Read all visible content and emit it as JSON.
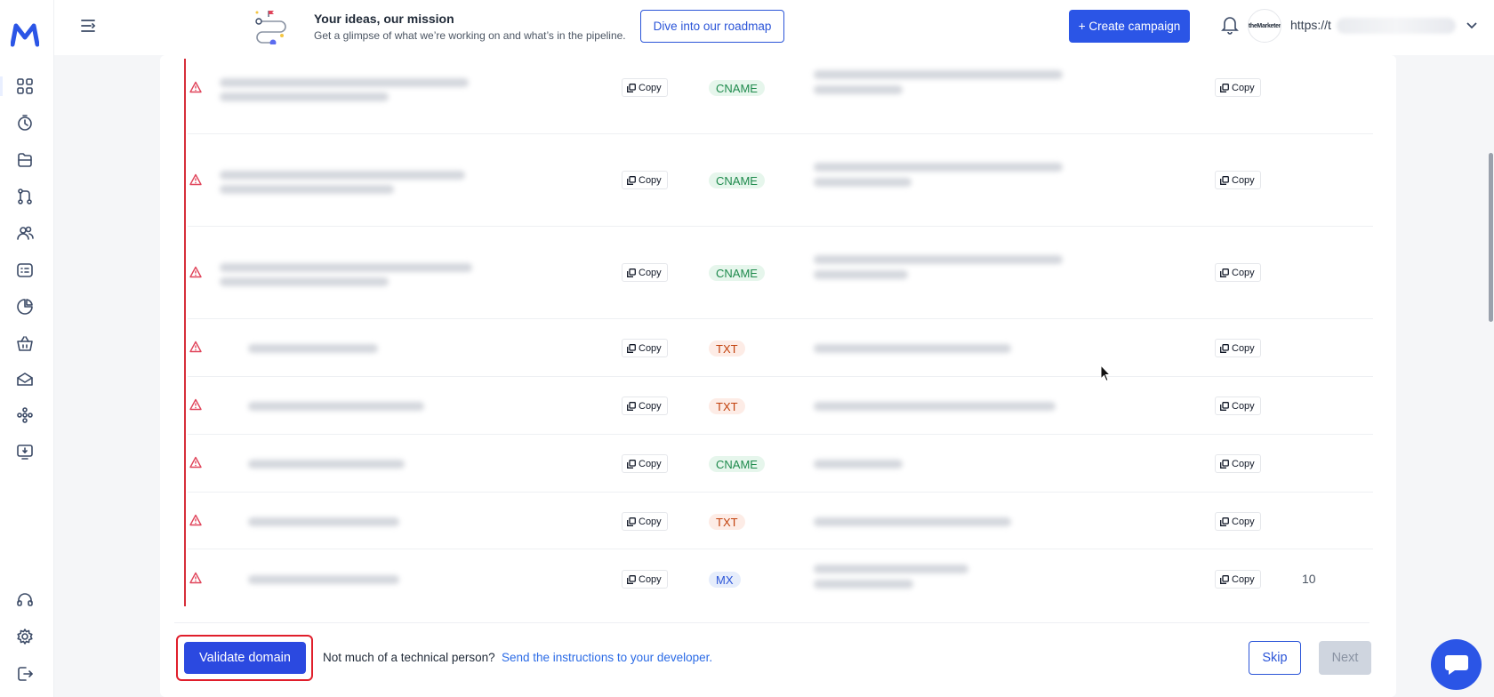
{
  "header": {
    "promo_title": "Your ideas, our mission",
    "promo_subtitle": "Get a glimpse of what we’re working on and what’s in the pipeline.",
    "roadmap_button": "Dive into our roadmap",
    "create_campaign_button": "+ Create campaign",
    "avatar_text": "theMarketer",
    "url_prefix": "https://t"
  },
  "sidebar": {
    "items": [
      "dashboard-icon",
      "clock-icon",
      "folder-icon",
      "flow-icon",
      "contacts-icon",
      "forms-icon",
      "chart-icon",
      "basket-icon",
      "mail-icon",
      "integrations-icon",
      "monitor-icon"
    ],
    "bottom_items": [
      "headset-icon",
      "gear-icon",
      "logout-icon"
    ]
  },
  "records": {
    "copy_label": "Copy",
    "rows": [
      {
        "type": "CNAME",
        "priority": ""
      },
      {
        "type": "CNAME",
        "priority": ""
      },
      {
        "type": "CNAME",
        "priority": ""
      },
      {
        "type": "TXT",
        "priority": ""
      },
      {
        "type": "TXT",
        "priority": ""
      },
      {
        "type": "CNAME",
        "priority": ""
      },
      {
        "type": "TXT",
        "priority": ""
      },
      {
        "type": "MX",
        "priority": "10"
      }
    ]
  },
  "footer": {
    "validate_button": "Validate domain",
    "not_technical": "Not much of a technical person?",
    "send_instructions_link": "Send the instructions to your developer.",
    "skip_button": "Skip",
    "next_button": "Next"
  },
  "colors": {
    "accent": "#2b55e6",
    "error": "#d62f3a"
  }
}
